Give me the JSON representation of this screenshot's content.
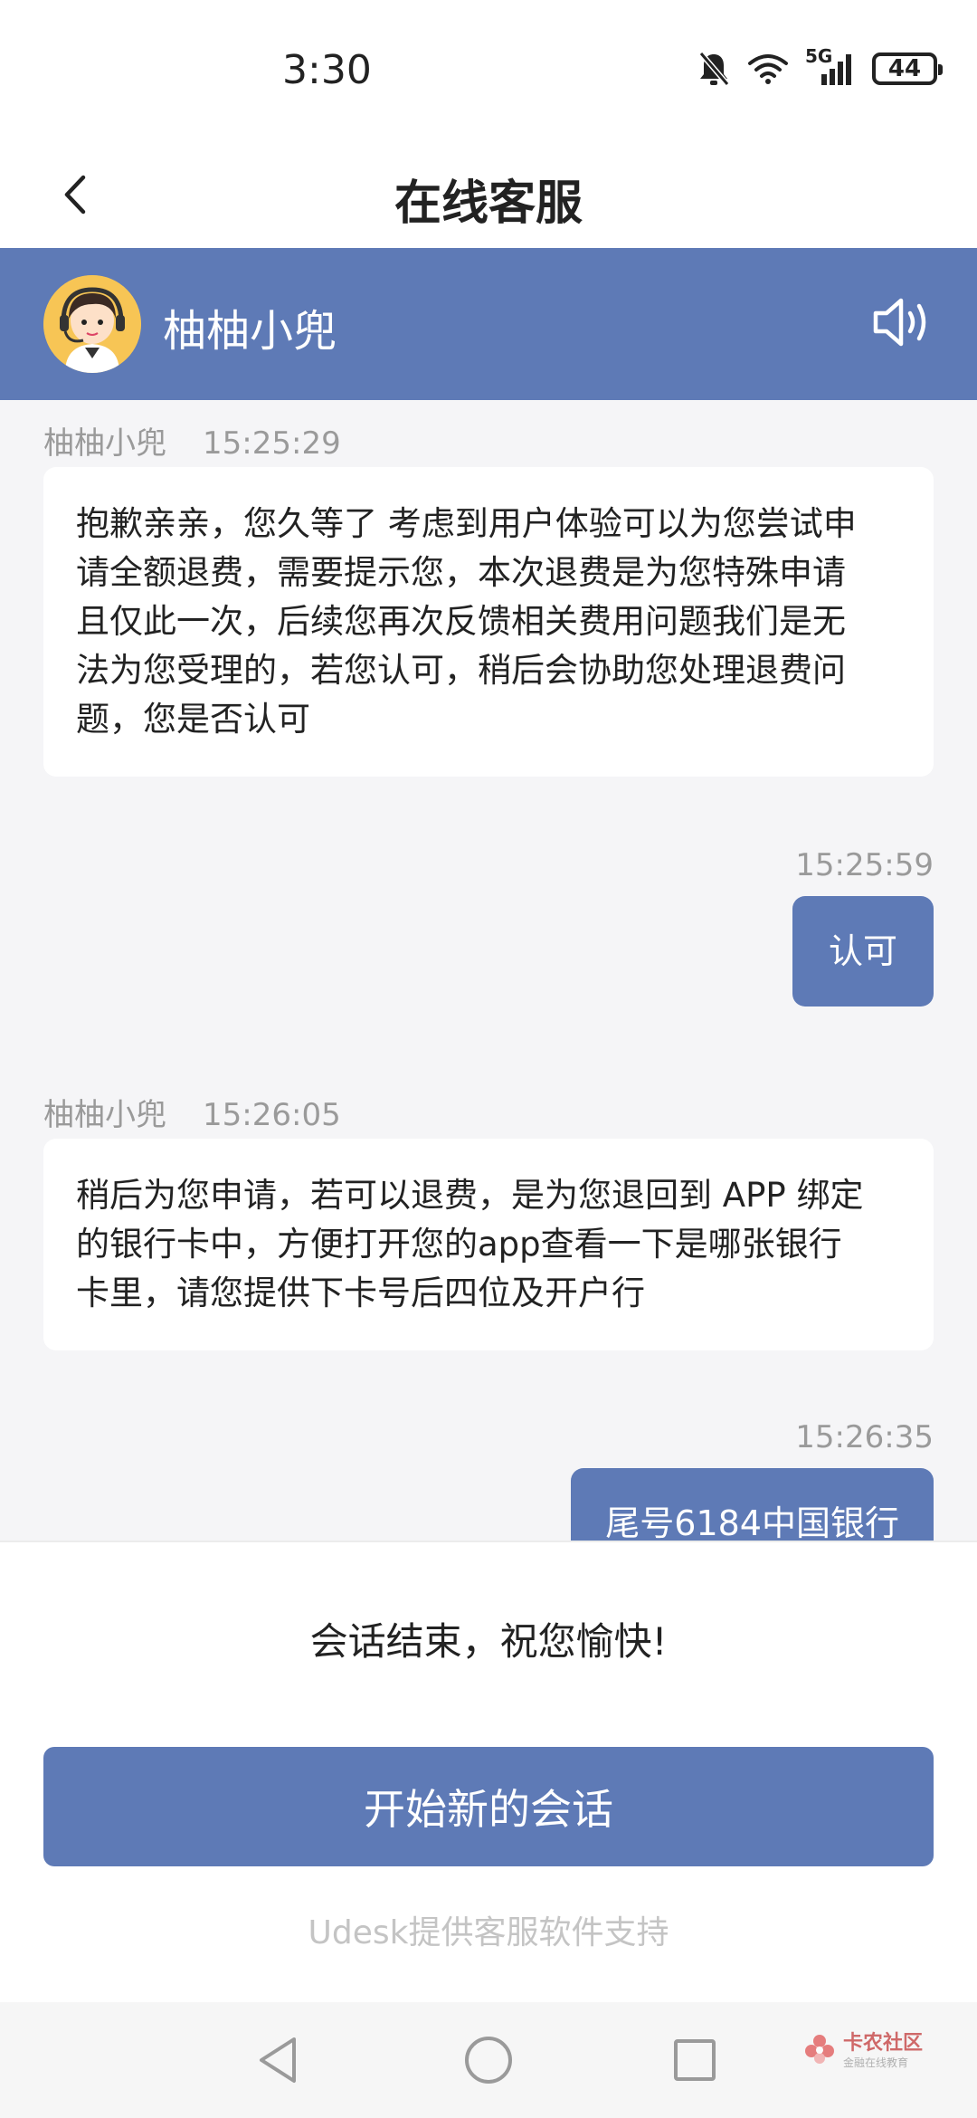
{
  "status_bar": {
    "time": "3:30",
    "network": "5G",
    "battery": "44",
    "icons": [
      "mute-bell-icon",
      "wifi-icon",
      "signal-icon",
      "battery-icon"
    ]
  },
  "header": {
    "title": "在线客服",
    "back_icon": "chevron-left-icon"
  },
  "agent_bar": {
    "name": "柚柚小兜",
    "avatar_icon": "agent-avatar-headset",
    "speaker_icon": "speaker-icon"
  },
  "messages": [
    {
      "direction": "in",
      "sender": "柚柚小兜",
      "time": "15:25:29",
      "lines": [
        "抱歉亲亲，您久等了 考虑到用户体验可以为您尝试申",
        "请全额退费，需要提示您，本次退费是为您特殊申请",
        "且仅此一次，后续您再次反馈相关费用问题我们是无",
        "法为您受理的，若您认可，稍后会协助您处理退费问",
        "题，您是否认可"
      ]
    },
    {
      "direction": "out",
      "time": "15:25:59",
      "text": "认可"
    },
    {
      "direction": "in",
      "sender": "柚柚小兜",
      "time": "15:26:05",
      "lines": [
        "稍后为您申请，若可以退费，是为您退回到 APP 绑定",
        "的银行卡中，方便打开您的app查看一下是哪张银行",
        "卡里，请您提供下卡号后四位及开户行"
      ]
    },
    {
      "direction": "out",
      "time": "15:26:35",
      "text": "尾号6184中国银行"
    }
  ],
  "footer": {
    "end_text": "会话结束，祝您愉快!",
    "new_chat_label": "开始新的会话",
    "powered_by": "Udesk提供客服软件支持"
  },
  "nav_bar": {
    "icons": [
      "back-triangle-icon",
      "home-circle-icon",
      "recents-square-icon"
    ],
    "watermark_title": "卡农社区",
    "watermark_sub": "金融在线教育"
  },
  "colors": {
    "accent": "#5e7ab6",
    "background": "#f5f5f7",
    "meta_text": "#9a9a9a"
  }
}
